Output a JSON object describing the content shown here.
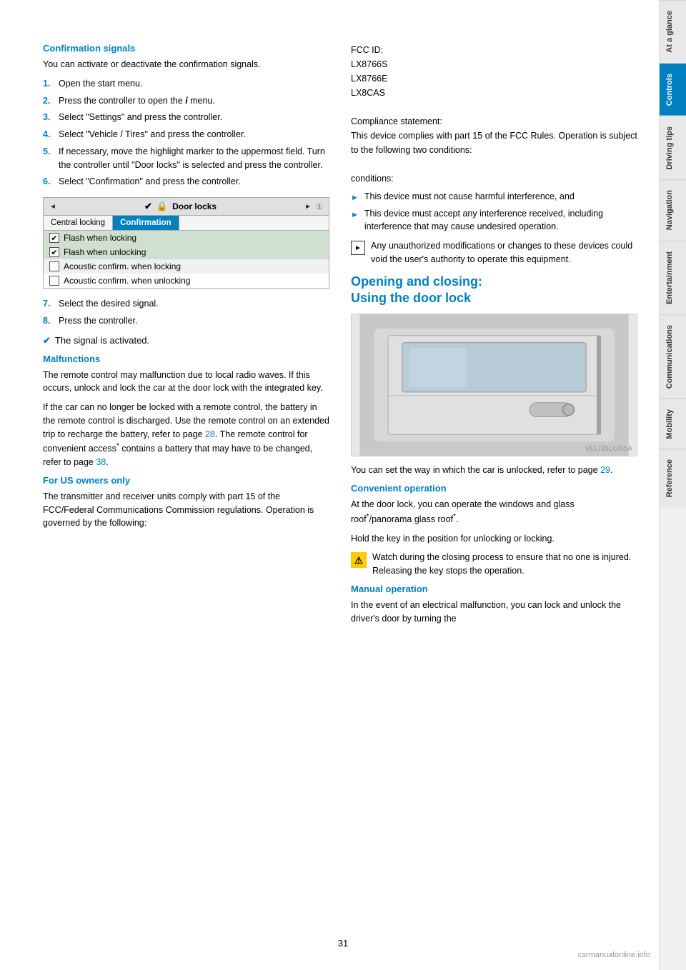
{
  "page": {
    "number": "31",
    "watermark": "carmanualonline.info"
  },
  "sidebar": {
    "tabs": [
      {
        "id": "at-a-glance",
        "label": "At a glance",
        "active": false
      },
      {
        "id": "controls",
        "label": "Controls",
        "active": true
      },
      {
        "id": "driving-tips",
        "label": "Driving tips",
        "active": false
      },
      {
        "id": "navigation",
        "label": "Navigation",
        "active": false
      },
      {
        "id": "entertainment",
        "label": "Entertainment",
        "active": false
      },
      {
        "id": "communications",
        "label": "Communications",
        "active": false
      },
      {
        "id": "mobility",
        "label": "Mobility",
        "active": false
      },
      {
        "id": "reference",
        "label": "Reference",
        "active": false
      }
    ]
  },
  "left_column": {
    "confirmation_signals": {
      "title": "Confirmation signals",
      "intro": "You can activate or deactivate the confirmation signals.",
      "steps": [
        {
          "num": "1.",
          "text": "Open the start menu."
        },
        {
          "num": "2.",
          "text": "Press the controller to open the  menu."
        },
        {
          "num": "3.",
          "text": "Select \"Settings\" and press the controller."
        },
        {
          "num": "4.",
          "text": "Select \"Vehicle / Tires\" and press the controller."
        },
        {
          "num": "5.",
          "text": "If necessary, move the highlight marker to the uppermost field. Turn the controller until \"Door locks\" is selected and press the controller."
        },
        {
          "num": "6.",
          "text": "Select \"Confirmation\" and press the controller."
        }
      ],
      "widget": {
        "header_left": "◄",
        "header_icon": "✓🔒",
        "header_text": "Door locks",
        "header_right": "►",
        "header_num": "①",
        "tab1": "Central locking",
        "tab2": "Confirmation",
        "options": [
          {
            "type": "checked",
            "label": "Flash when locking"
          },
          {
            "type": "checked",
            "label": "Flash when unlocking"
          },
          {
            "type": "unchecked",
            "label": "Acoustic confirm. when locking"
          },
          {
            "type": "unchecked",
            "label": "Acoustic confirm. when unlocking"
          }
        ]
      },
      "steps2": [
        {
          "num": "7.",
          "text": "Select the desired signal."
        },
        {
          "num": "8.",
          "text": "Press the controller."
        }
      ],
      "signal_activated": "The signal is activated."
    },
    "malfunctions": {
      "title": "Malfunctions",
      "para1": "The remote control may malfunction due to local radio waves. If this occurs, unlock and lock the car at the door lock with the integrated key.",
      "para2": "If the car can no longer be locked with a remote control, the battery in the remote control is discharged. Use the remote control on an extended trip to recharge the battery, refer to page 28. The remote control for convenient access* contains a battery that may have to be changed, refer to page 38."
    },
    "for_us_owners": {
      "title": "For US owners only",
      "para1": "The transmitter and receiver units comply with part 15 of the FCC/Federal Communications Commission regulations. Operation is governed by the following:"
    }
  },
  "right_column": {
    "fcc": {
      "id_label": "FCC ID:",
      "id_values": "LX8766S\nLX8766E\nLX8CAS",
      "compliance_label": "Compliance statement:",
      "compliance_text": "This device complies with part 15 of the FCC Rules. Operation is subject to the following two conditions:",
      "bullets": [
        "This device must not cause harmful interference, and",
        "This device must accept any interference received, including interference that may cause undesired operation."
      ],
      "notice_text": "Any unauthorized modifications or changes to these devices could void the user's authority to operate this equipment."
    },
    "opening_closing": {
      "title": "Opening and closing:\nUsing the door lock",
      "image_alt": "Car door lock illustration",
      "caption": "You can set the way in which the car is unlocked, refer to page 29.",
      "convenient_operation": {
        "title": "Convenient operation",
        "text": "At the door lock, you can operate the windows and glass roof*/panorama glass roof*.",
        "text2": "Hold the key in the position for unlocking or locking.",
        "warning": "Watch during the closing process to ensure that no one is injured. Releasing the key stops the operation."
      },
      "manual_operation": {
        "title": "Manual operation",
        "text": "In the event of an electrical malfunction, you can lock and unlock the driver's door by turning the"
      }
    }
  }
}
